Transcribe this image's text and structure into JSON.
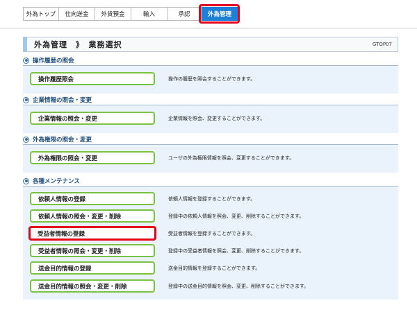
{
  "tabs": [
    {
      "label": "外為トップ",
      "active": false
    },
    {
      "label": "仕向送金",
      "active": false
    },
    {
      "label": "外貨預金",
      "active": false
    },
    {
      "label": "輸入",
      "active": false
    },
    {
      "label": "承認",
      "active": false
    },
    {
      "label": "外為管理",
      "active": true
    }
  ],
  "header": {
    "title": "外為管理　》　業務選択",
    "code": "GTOP07"
  },
  "sections": [
    {
      "title": "操作履歴の照会",
      "rows": [
        {
          "button": "操作履歴照会",
          "desc": "操作の履歴を照会することができます。"
        }
      ]
    },
    {
      "title": "企業情報の照会・変更",
      "rows": [
        {
          "button": "企業情報の照会・変更",
          "desc": "企業情報を照会、変更することができます。"
        }
      ]
    },
    {
      "title": "外為権限の照会・変更",
      "rows": [
        {
          "button": "外為権限の照会・変更",
          "desc": "ユーザの外為権限情報を照会、変更することができます。"
        }
      ]
    },
    {
      "title": "各種メンテナンス",
      "rows": [
        {
          "button": "依頼人情報の登録",
          "desc": "依頼人情報を登録することができます。"
        },
        {
          "button": "依頼人情報の照会・変更・削除",
          "desc": "登録中の依頼人情報を照会、変更、削除することができます。"
        },
        {
          "button": "受益者情報の登録",
          "desc": "受益者情報を登録することができます。"
        },
        {
          "button": "受益者情報の照会・変更・削除",
          "desc": "登録中の受益者情報を照会、変更、削除することができます。"
        },
        {
          "button": "送金目的情報の登録",
          "desc": "送金目的情報を登録することができます。"
        },
        {
          "button": "送金目的情報の照会・変更・削除",
          "desc": "登録中の送金目的情報を照会、変更、削除することができます。"
        }
      ]
    }
  ],
  "colors": {
    "active_tab": "#1e7fd6",
    "highlight": "#e2001a",
    "button_border": "#7cc242",
    "panel_bg": "#eaf3fb",
    "section_title": "#1f4d7a"
  }
}
